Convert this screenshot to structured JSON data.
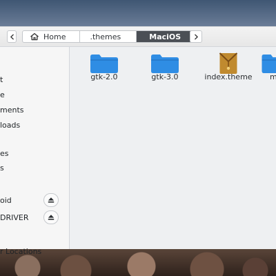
{
  "breadcrumbs": [
    {
      "label": "Home"
    },
    {
      "label": ".themes"
    },
    {
      "label": "MaciOS"
    }
  ],
  "sidebar": {
    "items": [
      {
        "label": "t"
      },
      {
        "label": "e"
      },
      {
        "label": "ments"
      },
      {
        "label": "loads"
      },
      {
        "label": "es"
      },
      {
        "label": "s"
      },
      {
        "label": "oid"
      },
      {
        "label": "DRIVER"
      },
      {
        "label": "r Locations"
      }
    ]
  },
  "files": [
    {
      "name": "gtk-2.0",
      "icon": "folder-icon"
    },
    {
      "name": "gtk-3.0",
      "icon": "folder-icon"
    },
    {
      "name": "index.theme",
      "icon": "theme-file-icon"
    },
    {
      "name": "m",
      "icon": "folder-icon"
    }
  ],
  "colors": {
    "folder": "#2f8de4",
    "active_crumb": "#4b4f55",
    "theme_file": "#c08a2f"
  }
}
